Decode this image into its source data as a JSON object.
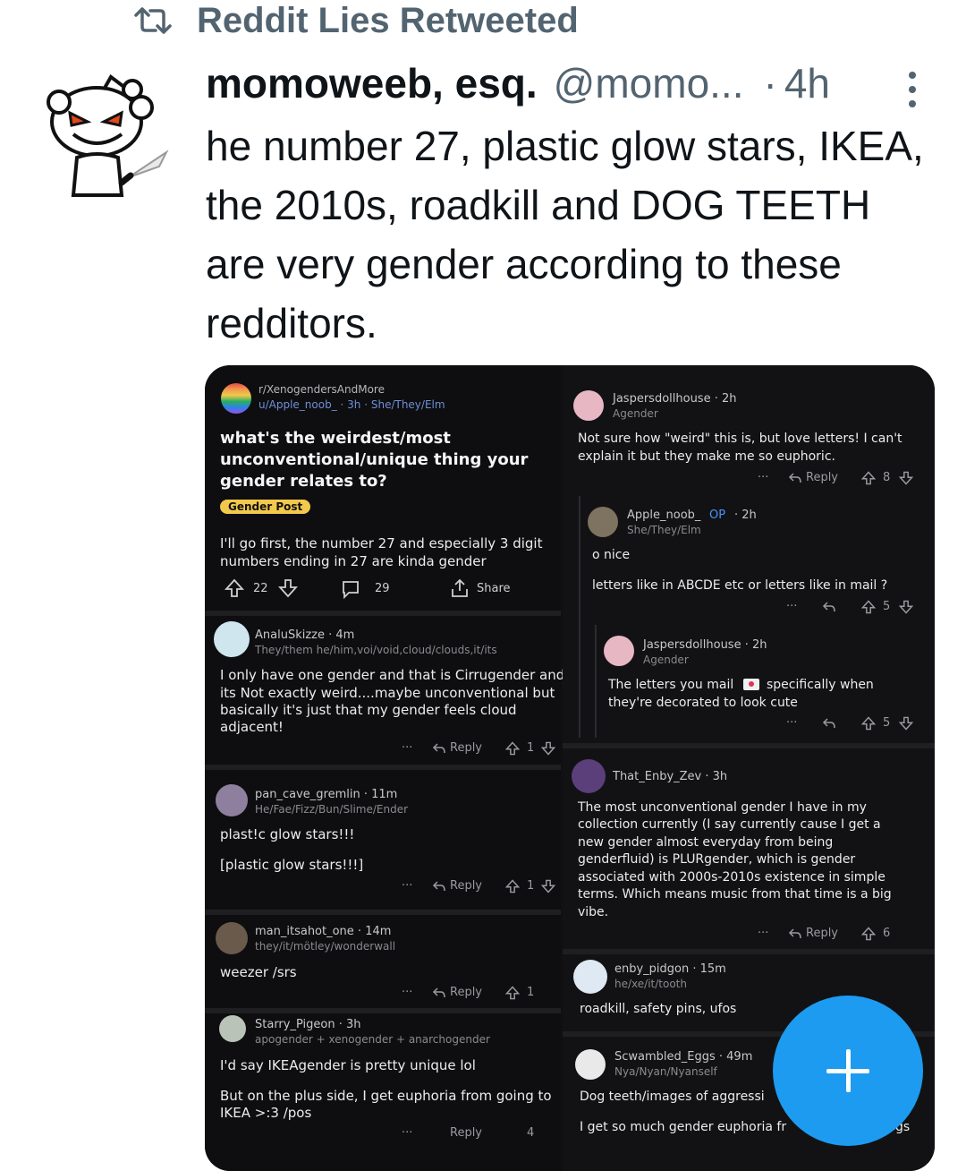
{
  "retweet": {
    "label": "Reddit Lies Retweeted"
  },
  "tweet": {
    "name": "momoweeb, esq.",
    "handle": "@momo...",
    "dot": "·",
    "time": "4h",
    "text": "he number 27, plastic glow stars, IKEA, the 2010s, roadkill and DOG TEETH are very gender according to these redditors."
  },
  "post": {
    "subreddit": "r/XenogendersAndMore",
    "author_line": "u/Apple_noob_ · 3h · She/They/Elm",
    "title_lines": [
      "what's the weirdest/most",
      "unconventional/unique thing your",
      "gender relates to?"
    ],
    "tag": "Gender Post",
    "body_lines": [
      "I'll go first, the number 27 and especially 3 digit",
      "numbers ending in 27 are kinda gender"
    ],
    "upvotes": "22",
    "comments": "29",
    "share": "Share"
  },
  "left_comments": [
    {
      "user": "AnaluSkizze · 4m",
      "flair": "They/them he/him,voi/void,cloud/clouds,it/its",
      "lines": [
        "I only have one gender and that is Cirrugender and",
        "its Not exactly weird....maybe unconventional but",
        "basically it's just that my gender feels cloud",
        "adjacent!"
      ],
      "dots": "···",
      "reply": "Reply",
      "votes": "1"
    },
    {
      "user": "pan_cave_gremlin · 11m",
      "flair": "He/Fae/Fizz/Bun/Slime/Ender",
      "lines": [
        "plast!c glow stars!!!",
        "",
        "[plastic glow stars!!!]"
      ],
      "dots": "···",
      "reply": "Reply",
      "votes": "1"
    },
    {
      "user": "man_itsahot_one · 14m",
      "flair": "they/it/mötley/wonderwall",
      "lines": [
        "weezer /srs"
      ],
      "dots": "···",
      "reply": "Reply",
      "votes": "1"
    },
    {
      "user": "Starry_Pigeon · 3h",
      "flair": "apogender + xenogender + anarchogender",
      "lines": [
        "I'd say IKEAgender is pretty unique lol",
        "",
        "But on the plus side, I get euphoria from going to",
        "IKEA >:3 /pos"
      ],
      "dots": "···",
      "reply": "Reply",
      "votes": "4"
    }
  ],
  "right_comments": [
    {
      "user": "Jaspersdollhouse · 2h",
      "flair": "Agender",
      "lines": [
        "Not sure how \"weird\" this is, but love letters! I can't",
        "explain it but they make me so euphoric."
      ],
      "dots": "···",
      "reply": "Reply",
      "votes": "8"
    },
    {
      "user": "Apple_noob_",
      "op": "OP",
      "time": "· 2h",
      "flair": "She/They/Elm",
      "lines": [
        "o nice",
        "",
        "letters like in ABCDE etc or letters like in mail ?"
      ],
      "dots": "···",
      "votes": "5"
    },
    {
      "user": "Jaspersdollhouse · 2h",
      "flair": "Agender",
      "lines": [
        "The letters you mail",
        "specifically when",
        "they're decorated to look cute"
      ],
      "dots": "···",
      "votes": "5"
    },
    {
      "user": "That_Enby_Zev · 3h",
      "lines": [
        "The most unconventional gender I have in my",
        "collection currently (I say currently cause I get a",
        "new gender almost everyday from being",
        "genderfluid) is PLURgender, which is gender",
        "associated with 2000s-2010s existence in simple",
        "terms. Which means music from that time is a big",
        "vibe."
      ],
      "dots": "···",
      "reply": "Reply",
      "votes": "6"
    },
    {
      "user": "enby_pidgon · 15m",
      "flair": "he/xe/it/tooth",
      "lines": [
        "roadkill, safety pins, ufos"
      ]
    },
    {
      "user": "Scwambled_Eggs · 49m",
      "flair": "Nya/Nyan/Nyanself",
      "lines": [
        "Dog teeth/images of aggressi",
        "I get so much gender euphoria fr",
        "gs"
      ]
    }
  ],
  "colors": {
    "accent": "#1d9bf0",
    "text": "#0f1419",
    "muted": "#536471",
    "reddit_dark": "#0e0e10",
    "tag": "#f2c94c"
  },
  "icons": [
    "retweet-icon",
    "more-vertical-icon",
    "reddit-snoo-avatar",
    "upvote-icon",
    "downvote-icon",
    "comment-icon",
    "share-icon",
    "reply-icon",
    "compose-plus-icon"
  ]
}
